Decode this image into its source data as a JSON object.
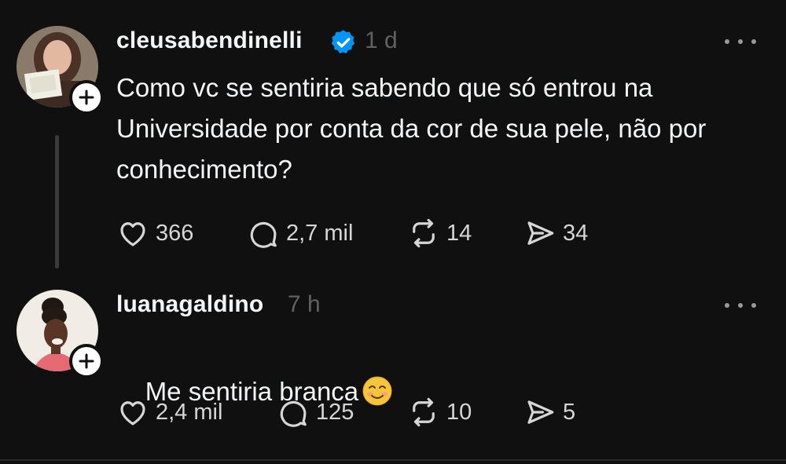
{
  "posts": [
    {
      "username": "cleusabendinelli",
      "verified": true,
      "time": "1 d",
      "text": "Como vc se sentiria sabendo que só entrou na\nUniversidade por conta da cor de sua pele, não por\nconhecimento?",
      "likes": "366",
      "replies": "2,7 mil",
      "reposts": "14",
      "shares": "34"
    },
    {
      "username": "luanagaldino",
      "verified": false,
      "time": "7 h",
      "text": "Me sentiria branca",
      "emoji": "smiling-face-emoji",
      "likes": "2,4 mil",
      "replies": "125",
      "reposts": "10",
      "shares": "5"
    }
  ],
  "colors": {
    "background": "#101010",
    "text": "#f3f5f7",
    "muted": "#616161",
    "verified": "#0095f6"
  },
  "icons": [
    "heart-icon",
    "comment-icon",
    "repost-icon",
    "share-icon",
    "more-icon",
    "follow-plus-icon",
    "verified-badge-icon"
  ]
}
